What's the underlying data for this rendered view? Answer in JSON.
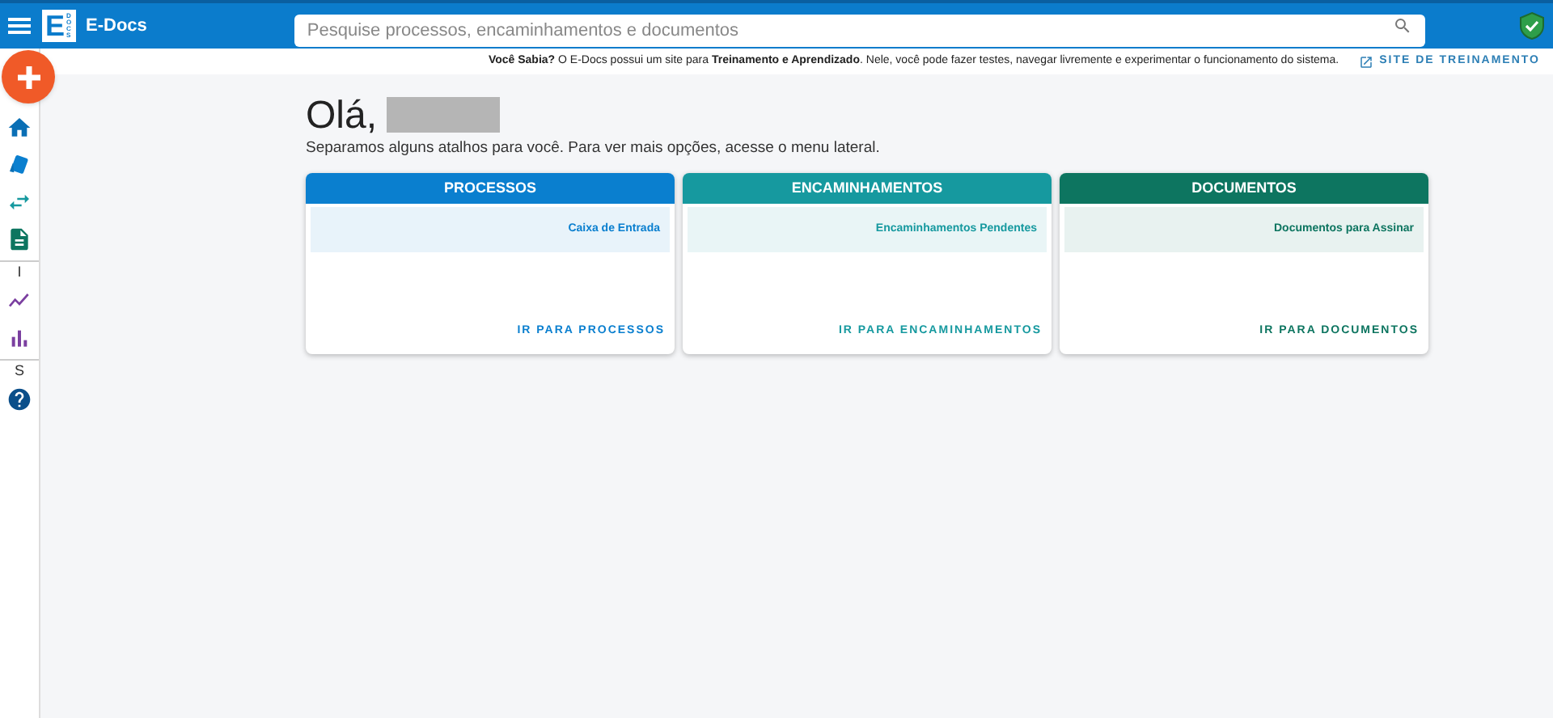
{
  "header": {
    "logo_letter": "E",
    "logo_sub": "DOCS",
    "app_name": "E-Docs",
    "search": {
      "placeholder": "Pesquise processos, encaminhamentos e documentos"
    }
  },
  "info_bar": {
    "text": "**Você Sabia?** O E-Docs possui um site para **Treinamento e Aprendizado**. Nele, você pode fazer testes, navegar livremente e experimentar o funcionamento do sistema.",
    "link": "SITE DE TREINAMENTO"
  },
  "sidebar": {
    "items": [
      {
        "kind": "icon"
      },
      {
        "kind": "icon"
      },
      {
        "kind": "icon"
      },
      {
        "kind": "icon"
      },
      {
        "kind": "label",
        "text": "I"
      },
      {
        "kind": "icon"
      },
      {
        "kind": "icon"
      },
      {
        "kind": "label",
        "text": "S"
      },
      {
        "kind": "icon"
      }
    ]
  },
  "greeting": {
    "title": "Olá,",
    "subtitle": "Separamos alguns atalhos para você. Para ver mais opções, acesse o menu lateral."
  },
  "cards": [
    {
      "title": "PROCESSOS",
      "color": "#0a7fcf",
      "shortcut": "Caixa de Entrada",
      "action": "IR PARA PROCESSOS"
    },
    {
      "title": "ENCAMINHAMENTOS",
      "color": "#16999f",
      "shortcut": "Encaminhamentos Pendentes",
      "action": "IR PARA ENCAMINHAMENTOS"
    },
    {
      "title": "DOCUMENTOS",
      "color": "#0d7560",
      "shortcut": "Documentos para Assinar",
      "action": "IR PARA DOCUMENTOS"
    }
  ]
}
